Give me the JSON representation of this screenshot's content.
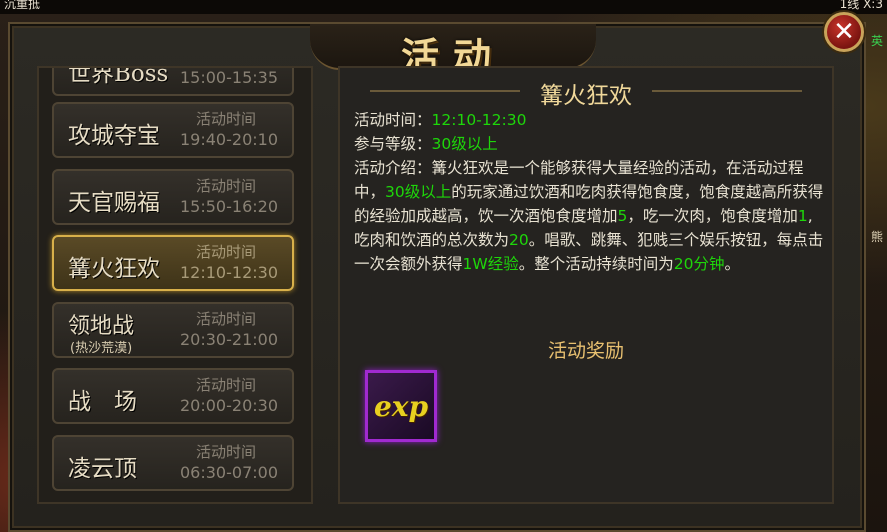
{
  "hud": {
    "top_left": "沉重抵",
    "top_right": "1线 X:3"
  },
  "side_fragments": {
    "right_a": "英",
    "right_b": "熊"
  },
  "window": {
    "title": "活动",
    "close_icon": "close-x-icon"
  },
  "activities": [
    {
      "name": "世界Boss",
      "time_label": "",
      "time": "15:00-15:35"
    },
    {
      "name": "攻城夺宝",
      "time_label": "活动时间",
      "time": "19:40-20:10"
    },
    {
      "name": "天官赐福",
      "time_label": "活动时间",
      "time": "15:50-16:20"
    },
    {
      "name": "篝火狂欢",
      "time_label": "活动时间",
      "time": "12:10-12:30",
      "selected": true
    },
    {
      "name": "领地战",
      "sub": "(热沙荒漠)",
      "time_label": "活动时间",
      "time": "20:30-21:00"
    },
    {
      "name": "战　场",
      "time_label": "活动时间",
      "time": "20:00-20:30"
    },
    {
      "name": "凌云顶",
      "time_label": "活动时间",
      "time": "06:30-07:00"
    }
  ],
  "detail": {
    "title": "篝火狂欢",
    "time_key": "活动时间：",
    "time_val": "12:10-12:30",
    "level_key": "参与等级：",
    "level_val": "30级以上",
    "intro_key": "活动介绍：",
    "intro_1": "篝火狂欢是一个能够获得大量经验的活动，在活动过程中，",
    "intro_2": "30级以上",
    "intro_3": "的玩家通过饮酒和吃肉获得饱食度，饱食度越高所获得的经验加成越高，饮一次酒饱食度增加",
    "intro_4": "5",
    "intro_5": "，吃一次肉，饱食度增加",
    "intro_6": "1",
    "intro_7": ",吃肉和饮酒的总次数为",
    "intro_8": "20",
    "intro_9": "。唱歌、跳舞、犯贱三个娱乐按钮，每点击一次会额外获得",
    "intro_10": "1W经验",
    "intro_11": "。整个活动持续时间为",
    "intro_12": "20分钟",
    "intro_13": "。",
    "reward_title": "活动奖励",
    "reward_item": "exp"
  },
  "colors": {
    "highlight": "#1ed60a",
    "gold": "#f0d89a",
    "selected_border": "#d8b04a",
    "epic_border": "#a02ad0"
  }
}
